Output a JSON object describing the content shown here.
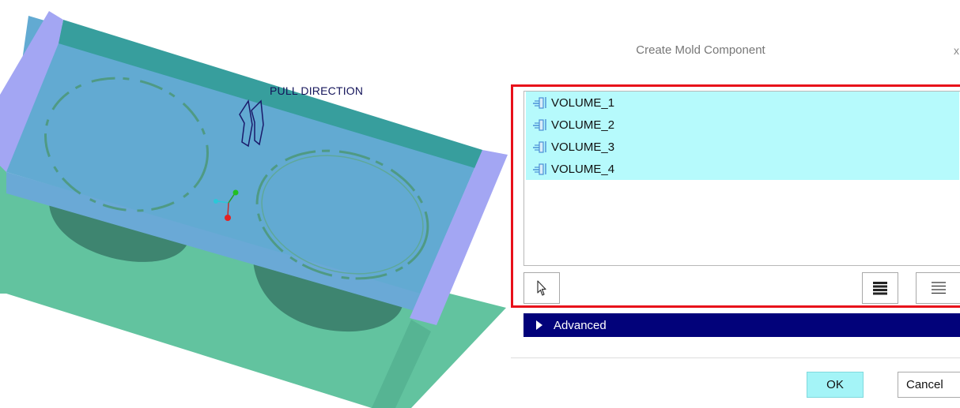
{
  "viewport": {
    "pull_direction_label": "PULL DIRECTION",
    "colors": {
      "top_plate": "#5ea8cf",
      "plate_edge": "#9fa3f2",
      "base_block": "#5fc39f",
      "cylinder": "#3b7f6a"
    }
  },
  "dialog": {
    "title": "Create Mold Component",
    "close_label": "x",
    "list": {
      "items": [
        {
          "label": "VOLUME_1",
          "icon": "volume-icon"
        },
        {
          "label": "VOLUME_2",
          "icon": "volume-icon"
        },
        {
          "label": "VOLUME_3",
          "icon": "volume-icon"
        },
        {
          "label": "VOLUME_4",
          "icon": "volume-icon"
        }
      ],
      "selection_color": "#b6fafc"
    },
    "toolbar": {
      "select_icon": "pointer-icon",
      "select_all_icon": "select-all-icon",
      "deselect_all_icon": "deselect-all-icon"
    },
    "advanced": {
      "label": "Advanced",
      "color": "#02027a"
    },
    "buttons": {
      "ok_label": "OK",
      "cancel_label": "Cancel"
    },
    "highlight_color": "#e8101a"
  }
}
